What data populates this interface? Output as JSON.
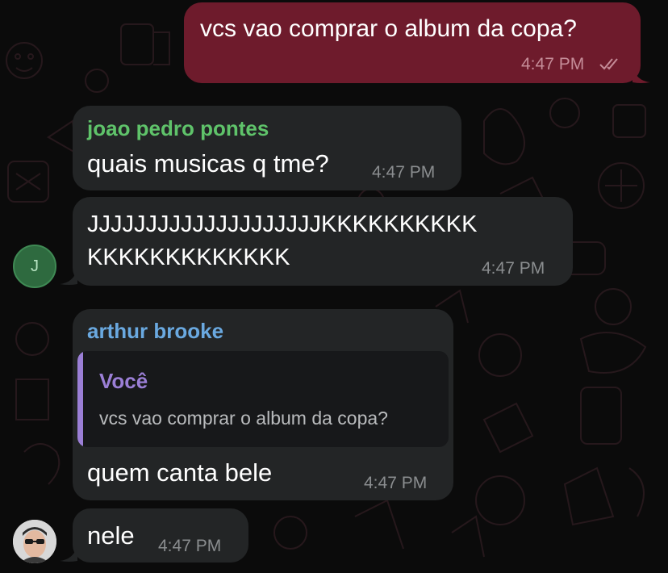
{
  "colors": {
    "outgoing_bubble": "#6e1b2c",
    "incoming_bubble": "#232526",
    "sender_joao": "#5fc36a",
    "sender_arthur": "#6aa9e0",
    "quote_author": "#9b7fd6",
    "quote_bar": "#9b7fd6",
    "timestamp": "#8a8d8f"
  },
  "messages": [
    {
      "direction": "outgoing",
      "text": "vcs vao comprar o album da copa?",
      "time": "4:47 PM",
      "status_icon": "double-check-icon"
    },
    {
      "direction": "incoming",
      "sender": "joao pedro pontes",
      "text": "quais musicas q tme?",
      "time": "4:47 PM"
    },
    {
      "direction": "incoming",
      "text_line1": "JJJJJJJJJJJJJJJJJJJJKKKKKKKKKK",
      "text_line2": "KKKKKKKKKKKKK",
      "time": "4:47 PM",
      "avatar_letter": "J"
    },
    {
      "direction": "incoming",
      "sender": "arthur brooke",
      "reply_to": {
        "author": "Você",
        "text": "vcs vao comprar o album da copa?"
      },
      "text": "quem canta bele",
      "time": "4:47 PM"
    },
    {
      "direction": "incoming",
      "text": "nele",
      "time": "4:47 PM",
      "avatar": "user-photo-avatar"
    }
  ]
}
